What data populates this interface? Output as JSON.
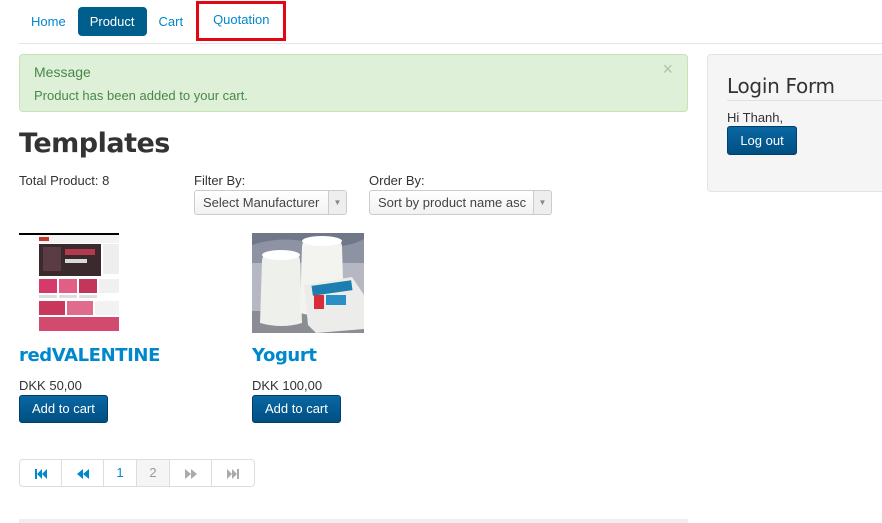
{
  "nav": {
    "items": [
      {
        "label": "Home"
      },
      {
        "label": "Product"
      },
      {
        "label": "Cart"
      },
      {
        "label": "Quotation"
      }
    ]
  },
  "alert": {
    "heading": "Message",
    "text": "Product has been added to your cart.",
    "close": "×"
  },
  "page": {
    "title": "Templates",
    "total": "Total Product: 8"
  },
  "filters": {
    "filter_label": "Filter By:",
    "filter_value": "Select Manufacturer",
    "order_label": "Order By:",
    "order_value": "Sort by product name asc",
    "arrow": "▼"
  },
  "products": [
    {
      "name": "redVALENTINE",
      "price": "DKK 50,00",
      "button": "Add to cart",
      "icon": "template-thumbnail"
    },
    {
      "name": "Yogurt",
      "price": "DKK 100,00",
      "button": "Add to cart",
      "icon": "yogurt-photo"
    }
  ],
  "pagination": {
    "first": "⏮",
    "prev": "⏪",
    "pages": [
      "1",
      "2"
    ],
    "next": "⏩",
    "last": "⏭"
  },
  "login": {
    "title": "Login Form",
    "greeting": "Hi Thanh,",
    "logout": "Log out"
  },
  "colors": {
    "link": "#0088cc",
    "primary": "#005e8d",
    "alert_bg": "#dff0d8",
    "alert_text": "#468847",
    "highlight": "#e30613"
  }
}
